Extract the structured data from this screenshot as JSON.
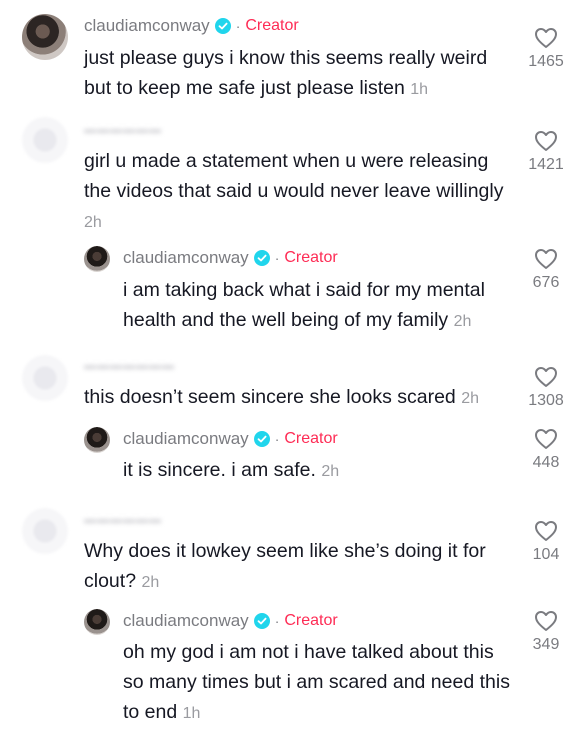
{
  "comments": [
    {
      "username": "claudiamconway",
      "creator_badge": "Creator",
      "text": "just please guys i know this seems really weird but to keep me safe just please listen",
      "time": "1h",
      "likes": "1465"
    },
    {
      "text": "girl u made a statement when u were releasing the videos that said u would never leave willingly",
      "time": "2h",
      "likes": "1421",
      "reply": {
        "username": "claudiamconway",
        "creator_badge": "Creator",
        "text": "i am taking back what i said for my mental health and the well being of my family",
        "time": "2h",
        "likes": "676"
      }
    },
    {
      "text": "this doesn’t seem sincere she looks scared",
      "time": "2h",
      "likes": "1308",
      "reply": {
        "username": "claudiamconway",
        "creator_badge": "Creator",
        "text": "it is sincere. i am safe.",
        "time": "2h",
        "likes": "448"
      }
    },
    {
      "text": "Why does it lowkey seem like she’s doing it for clout?",
      "time": "2h",
      "likes": "104",
      "reply": {
        "username": "claudiamconway",
        "creator_badge": "Creator",
        "text": "oh my god i am not i have talked about this so many times but i am scared and need this to end",
        "time": "1h",
        "likes": "349"
      }
    }
  ],
  "colors": {
    "creator": "#fe2c55",
    "verified": "#20d5ec",
    "text": "#161823",
    "muted": "#7a7b80"
  },
  "icons": {
    "like": "heart-outline-icon",
    "verified": "verified-check-icon"
  }
}
